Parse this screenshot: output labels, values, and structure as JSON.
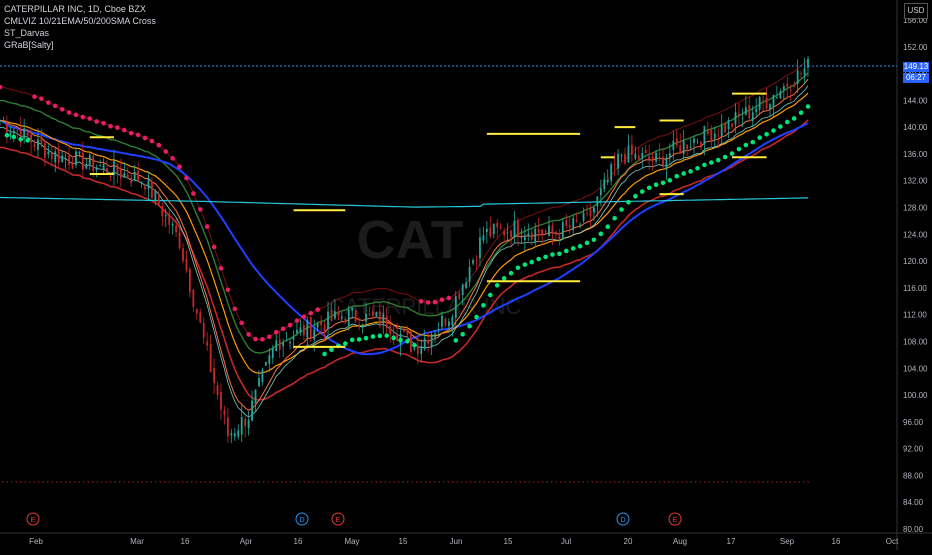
{
  "legend": {
    "symbol": "CATERPILLAR INC, 1D, Cboe BZX",
    "indicator1": "CMLVIZ 10/21EMA/50/200SMA Cross",
    "indicator2": "ST_Darvas",
    "indicator3": "GRaB[Salty]"
  },
  "watermark": {
    "ticker": "CAT",
    "name": "CATERPILLAR INC"
  },
  "currency": "USD",
  "last_price": "149.13",
  "countdown": "06:27",
  "colors": {
    "background": "#000000",
    "accent": "#2962ff",
    "up": "#26a69a",
    "down": "#ef5350",
    "darvas": "#ffeb3b",
    "grab_green": "#00e676",
    "grab_red": "#e91e63"
  },
  "chart_data": {
    "type": "candlestick",
    "y_ticks": [
      "156.00",
      "152.00",
      "148.00",
      "144.00",
      "140.00",
      "136.00",
      "132.00",
      "128.00",
      "124.00",
      "120.00",
      "116.00",
      "112.00",
      "108.00",
      "104.00",
      "100.00",
      "96.00",
      "92.00",
      "88.00",
      "84.00",
      "80.00"
    ],
    "ylim": [
      80,
      156
    ],
    "x_ticks": [
      "Feb",
      "Mar",
      "16",
      "Apr",
      "16",
      "May",
      "15",
      "Jun",
      "15",
      "Jul",
      "20",
      "Aug",
      "17",
      "Sep",
      "16",
      "Oct"
    ],
    "last_price": 149.13,
    "event_markers": [
      {
        "label": "E",
        "kind": "earnings"
      },
      {
        "label": "D",
        "kind": "dividend"
      },
      {
        "label": "E",
        "kind": "earnings"
      },
      {
        "label": "D",
        "kind": "dividend"
      },
      {
        "label": "E",
        "kind": "earnings"
      }
    ],
    "darvas_boxes": [
      {
        "from_day": 26,
        "to_day": 33,
        "high": 138.5,
        "low": 133.0
      },
      {
        "from_day": 85,
        "to_day": 100,
        "high": 127.6,
        "low": 107.2
      },
      {
        "from_day": 141,
        "to_day": 168,
        "high": 139.0,
        "low": 117.0
      },
      {
        "from_day": 174,
        "to_day": 178,
        "high": 135.5,
        "low": 135.5
      },
      {
        "from_day": 178,
        "to_day": 184,
        "high": 140.0,
        "low": 140.0
      },
      {
        "from_day": 191,
        "to_day": 198,
        "high": 141.0,
        "low": 130.0
      },
      {
        "from_day": 212,
        "to_day": 222,
        "high": 145.0,
        "low": 135.5
      }
    ]
  }
}
